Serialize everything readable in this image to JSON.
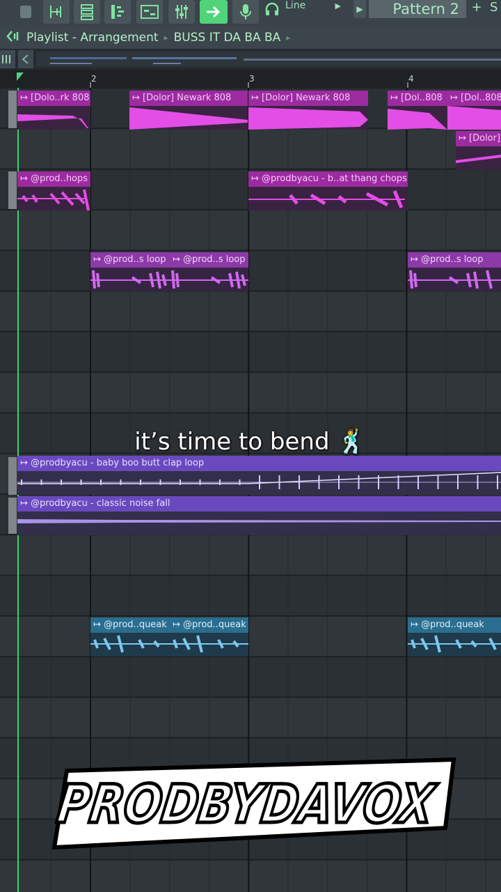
{
  "toolbar": {
    "mode_label": "Line",
    "pattern_label": "Pattern 2",
    "plus": "+",
    "trailing": "S"
  },
  "window": {
    "title": "Playlist - Arrangement",
    "separator": "▸",
    "song": "BUSS IT DA BA BA",
    "separator2": "▸"
  },
  "ruler": {
    "bars": [
      "2",
      "3",
      "4"
    ]
  },
  "clips": [
    {
      "label": "[Dolo..rk 808",
      "color": "#e24ee6"
    },
    {
      "label": "[Dolor] Newark 808",
      "color": "#e24ee6"
    },
    {
      "label": "[Dolor] Newark 808",
      "color": "#e24ee6"
    },
    {
      "label": "[Dol..808",
      "color": "#e24ee6"
    },
    {
      "label": "[Dol..808",
      "color": "#e24ee6"
    },
    {
      "label": "[Dolor]",
      "color": "#e24ee6"
    },
    {
      "label": "@prod..hops",
      "color": "#e24ee6"
    },
    {
      "label": "@prodbyacu - b..at thang chops",
      "color": "#e24ee6"
    },
    {
      "label": "@prod..s loop",
      "color": "#d068f0"
    },
    {
      "label": "@prod..s loop",
      "color": "#d068f0"
    },
    {
      "label": "@prod..s loop",
      "color": "#d068f0"
    },
    {
      "label": "@prodbyacu - baby boo butt clap loop",
      "color": "#8a5fd6"
    },
    {
      "label": "@prodbyacu - classic noise fall",
      "color": "#8a5fd6"
    },
    {
      "label": "@prod..queak",
      "color": "#7cc8ee"
    },
    {
      "label": "@prod..queak",
      "color": "#7cc8ee"
    },
    {
      "label": "@prod..queak",
      "color": "#7cc8ee"
    }
  ],
  "caption": "it’s time to bend 🕺",
  "watermark": "PRODBYDAVOX",
  "colors": {
    "accent": "#4fd47a",
    "playhead": "#3ad46a",
    "pink": "#e24ee6",
    "purple": "#8a5fd6",
    "blue": "#7cc8ee"
  },
  "icons": [
    "drum-icon",
    "snap-icon",
    "channel-rack-icon",
    "piano-roll-icon",
    "playlist-icon",
    "mixer-icon",
    "arrow-right-icon",
    "microphone-icon",
    "headphones-icon",
    "play-icon",
    "speaker-icon",
    "clip-arrow-icon"
  ]
}
